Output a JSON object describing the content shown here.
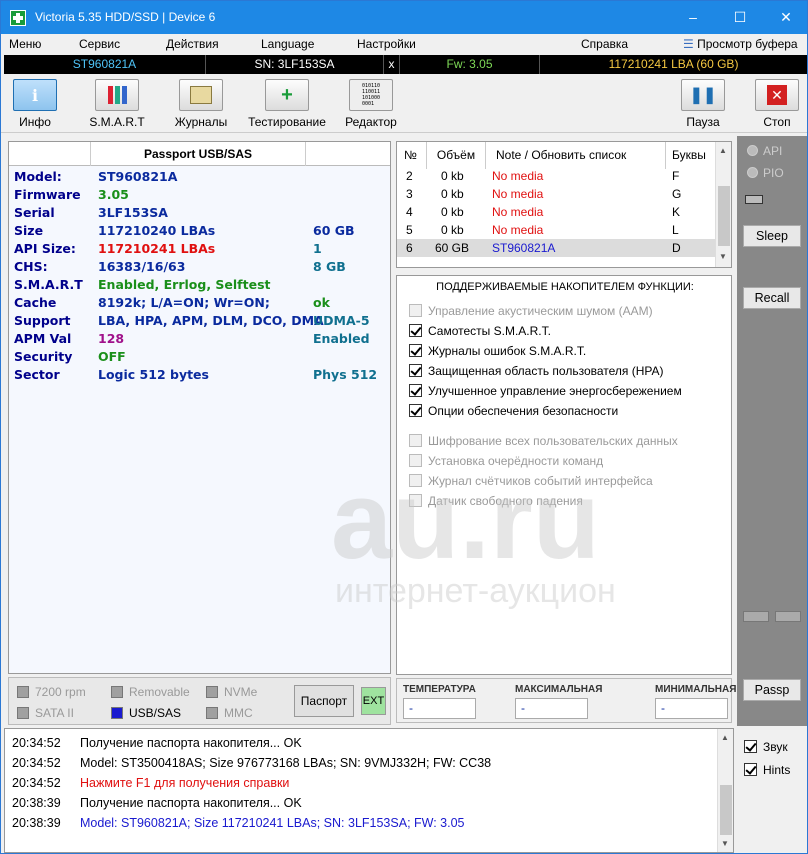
{
  "window": {
    "title": "Victoria 5.35 HDD/SSD | Device 6",
    "minimize": "–",
    "maximize": "☐",
    "close": "✕"
  },
  "menu": {
    "items": [
      "Меню",
      "Сервис",
      "Действия",
      "Language",
      "Настройки",
      "Справка"
    ],
    "buffer_view": "Просмотр буфера"
  },
  "infobar": {
    "model": "ST960821A",
    "sn": "SN: 3LF153SA",
    "x": "x",
    "fw": "Fw: 3.05",
    "lba": "117210241 LBA (60 GB)"
  },
  "toolbar": {
    "buttons": [
      {
        "label": "Инфо",
        "icon": "info-icon",
        "active": true
      },
      {
        "label": "S.M.A.R.T",
        "icon": "smart-icon"
      },
      {
        "label": "Журналы",
        "icon": "logs-icon"
      },
      {
        "label": "Тестирование",
        "icon": "test-icon"
      },
      {
        "label": "Редактор",
        "icon": "editor-icon",
        "glyph": "010110\n110011\n101000\n0001"
      }
    ],
    "pause": "Пауза",
    "stop": "Стоп"
  },
  "passport": {
    "title": "Passport USB/SAS",
    "rows": [
      {
        "key": "Model:",
        "value": "ST960821A",
        "extra": ""
      },
      {
        "key": "Firmware",
        "value": "3.05",
        "extra": ""
      },
      {
        "key": "Serial",
        "value": "3LF153SA",
        "extra": ""
      },
      {
        "key": "Size",
        "value": "117210240 LBAs",
        "extra": "60 GB"
      },
      {
        "key": "API Size:",
        "value": "117210241 LBAs",
        "extra": "1"
      },
      {
        "key": "CHS:",
        "value": "16383/16/63",
        "extra": "8 GB"
      },
      {
        "key": "S.M.A.R.T",
        "value": "Enabled, Errlog, Selftest",
        "extra": ""
      },
      {
        "key": "Cache",
        "value": "8192k; L/A=ON; Wr=ON;",
        "extra": "ok"
      },
      {
        "key": "Support",
        "value": "LBA, HPA, APM, DLM, DCO, DMA",
        "extra": "UDMA-5"
      },
      {
        "key": "APM Val",
        "value": "128",
        "extra": "Enabled"
      },
      {
        "key": "Security",
        "value": "OFF",
        "extra": ""
      },
      {
        "key": "Sector",
        "value": "Logic 512 bytes",
        "extra": "Phys 512"
      }
    ]
  },
  "flags": {
    "rpm": "7200 rpm",
    "removable": "Removable",
    "nvme": "NVMe",
    "sata": "SATA II",
    "usb": "USB/SAS",
    "mmc": "MMC",
    "passport_btn": "Паспорт",
    "ext_btn": "EXT"
  },
  "devices": {
    "headers": [
      "№",
      "Объём",
      "Note / Обновить список",
      "Буквы"
    ],
    "rows": [
      {
        "n": "2",
        "size": "0 kb",
        "note": "No media",
        "letter": "F"
      },
      {
        "n": "3",
        "size": "0 kb",
        "note": "No media",
        "letter": "G"
      },
      {
        "n": "4",
        "size": "0 kb",
        "note": "No media",
        "letter": "K"
      },
      {
        "n": "5",
        "size": "0 kb",
        "note": "No media",
        "letter": "L"
      },
      {
        "n": "6",
        "size": "60 GB",
        "note": "ST960821A",
        "letter": "D"
      }
    ]
  },
  "features": {
    "title": "ПОДДЕРЖИВАЕМЫЕ НАКОПИТЕЛЕМ ФУНКЦИИ:",
    "group1": [
      {
        "label": "Управление акустическим шумом (AAM)",
        "checked": false,
        "enabled": false
      },
      {
        "label": "Самотесты S.M.A.R.T.",
        "checked": true,
        "enabled": true
      },
      {
        "label": "Журналы ошибок S.M.A.R.T.",
        "checked": true,
        "enabled": true
      },
      {
        "label": "Защищенная область пользователя (HPA)",
        "checked": true,
        "enabled": true
      },
      {
        "label": "Улучшенное управление энергосбережением",
        "checked": true,
        "enabled": true
      },
      {
        "label": "Опции обеспечения безопасности",
        "checked": true,
        "enabled": true
      }
    ],
    "group2": [
      {
        "label": "Шифрование всех пользовательских данных",
        "checked": false,
        "enabled": false
      },
      {
        "label": "Установка очерёдности команд",
        "checked": false,
        "enabled": false
      },
      {
        "label": "Журнал счётчиков событий интерфейса",
        "checked": false,
        "enabled": false
      },
      {
        "label": "Датчик свободного падения",
        "checked": false,
        "enabled": false
      }
    ]
  },
  "temperature": {
    "current_label": "ТЕМПЕРАТУРА",
    "max_label": "МАКСИМАЛЬНАЯ",
    "min_label": "МИНИМАЛЬНАЯ",
    "current": "-",
    "max": "-",
    "min": "-"
  },
  "rightpanel": {
    "api": "API",
    "pio": "PIO",
    "sleep": "Sleep",
    "recall": "Recall",
    "passp": "Passp"
  },
  "log": [
    {
      "time": "20:34:52",
      "text": "Получение паспорта накопителя... OK",
      "color": "#000000"
    },
    {
      "time": "20:34:52",
      "text": "Model: ST3500418AS; Size 976773168 LBAs; SN: 9VMJ332H; FW: CC38",
      "color": "#000000"
    },
    {
      "time": "20:34:52",
      "text": "Нажмите F1 для получения справки",
      "color": "#e01010"
    },
    {
      "time": "20:38:39",
      "text": "Получение паспорта накопителя... OK",
      "color": "#000000"
    },
    {
      "time": "20:38:39",
      "text": "Model: ST960821A; Size 117210241 LBAs; SN: 3LF153SA; FW: 3.05",
      "color": "#1a1acf"
    }
  ],
  "options": {
    "sound": "Звук",
    "hints": "Hints",
    "sound_checked": true,
    "hints_checked": true
  },
  "watermark": {
    "main": "au.ru",
    "sub": "интернет-аукцион"
  }
}
